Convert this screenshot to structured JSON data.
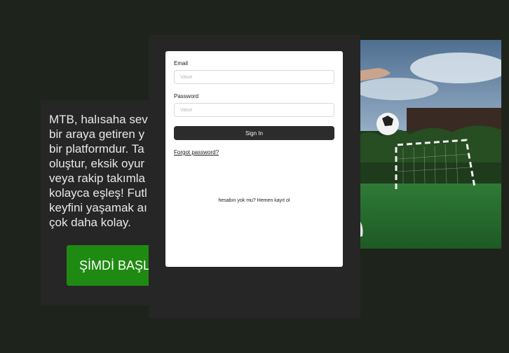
{
  "promo": {
    "text": "MTB, halısaha sev\nbir araya getiren y\nbir platformdur. Ta\noluştur, eksik oyur\nveya rakip takımla\nkolayca eşleş! Futl\nkeyfini yaşamak aı\nçok daha kolay.",
    "cta_label": "ŞİMDİ BAŞL"
  },
  "login": {
    "email_label": "Email",
    "email_placeholder": "Value",
    "password_label": "Password",
    "password_placeholder": "Value",
    "signin_label": "Sign In",
    "forgot_label": "Forgot password?",
    "register_label": "hesabın yok mu? Hemen kayıt ol"
  },
  "colors": {
    "background": "#1e241b",
    "panel": "#262626",
    "cta": "#1f8a12",
    "signin_button": "#2c2c2c"
  },
  "photo": {
    "icon": "football-goal-photo"
  }
}
